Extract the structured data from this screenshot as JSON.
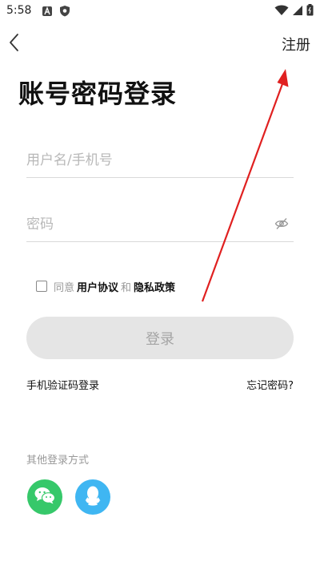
{
  "status_bar": {
    "time": "5:58",
    "left_icons": [
      "notification-a-icon",
      "shield-icon"
    ],
    "right_icons": [
      "wifi-icon",
      "signal-icon",
      "battery-icon"
    ]
  },
  "nav": {
    "back_icon": "chevron-left-icon",
    "register_label": "注册"
  },
  "title": "账号密码登录",
  "form": {
    "username_placeholder": "用户名/手机号",
    "username_value": "",
    "password_placeholder": "密码",
    "password_value": ""
  },
  "agreement": {
    "checked": false,
    "prefix": "同意",
    "user_agreement": "用户协议",
    "and": "和",
    "privacy_policy": "隐私政策"
  },
  "login_button": "登录",
  "links": {
    "sms_login": "手机验证码登录",
    "forgot_password": "忘记密码?"
  },
  "other_login": {
    "title": "其他登录方式",
    "methods": [
      "wechat-icon",
      "qq-icon"
    ]
  },
  "colors": {
    "wechat": "#36c86a",
    "qq": "#3fb6f2",
    "button_bg": "#e5e5e5",
    "annotation_arrow": "#e02020"
  }
}
